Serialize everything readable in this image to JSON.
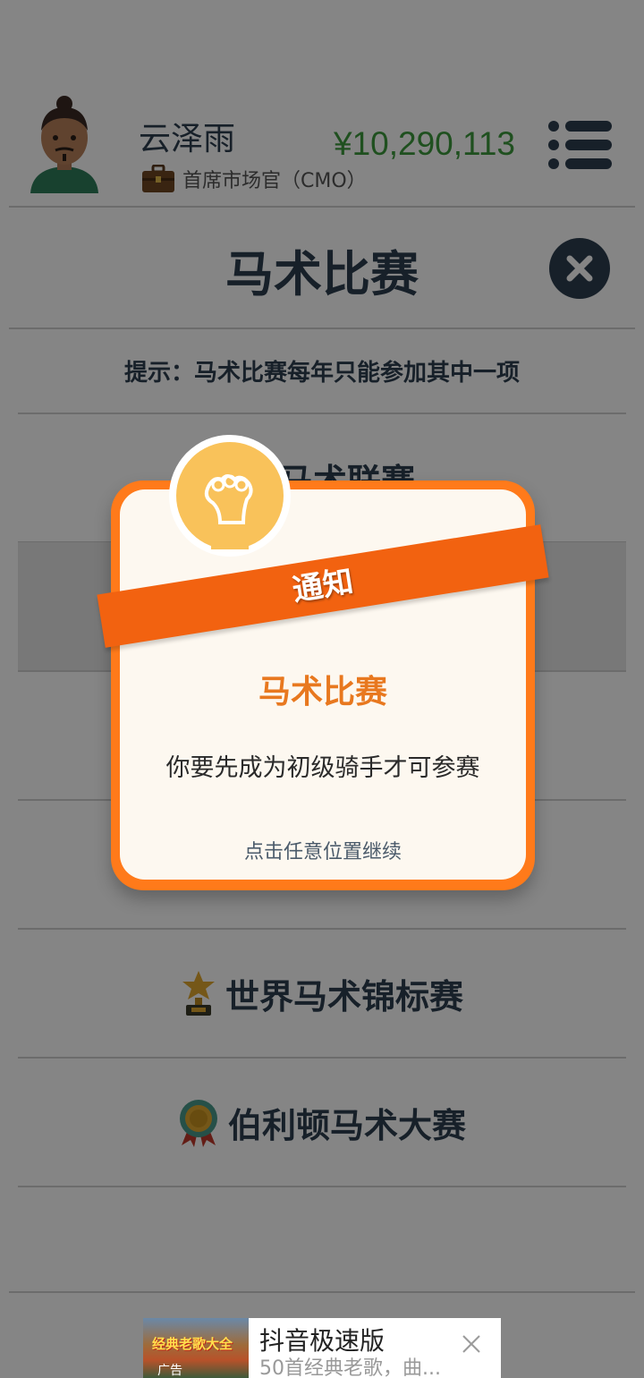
{
  "header": {
    "user_name": "云泽雨",
    "role": "首席市场官（CMO）",
    "money": "¥10,290,113",
    "money_color": "#3c9a3c"
  },
  "page": {
    "title": "马术比赛",
    "hint": "提示：马术比赛每年只能参加其中一项"
  },
  "competitions": [
    {
      "label": "马术联赛",
      "icon": "medal-ribbon-icon"
    },
    {
      "label": "",
      "icon": ""
    },
    {
      "label": "",
      "icon": ""
    },
    {
      "label": "",
      "icon": ""
    },
    {
      "label": "世界马术锦标赛",
      "icon": "trophy-icon"
    },
    {
      "label": "伯利顿马术大赛",
      "icon": "rosette-medal-icon"
    }
  ],
  "modal": {
    "ribbon": "通知",
    "title": "马术比赛",
    "message": "你要先成为初级骑手才可参赛",
    "hint": "点击任意位置继续",
    "accent": "#ff7a1a",
    "icon": "lightbulb-icon"
  },
  "ad": {
    "image_text": "经典老歌大全",
    "tag": "广告",
    "title": "抖音极速版",
    "subtitle": "50首经典老歌，曲..."
  }
}
